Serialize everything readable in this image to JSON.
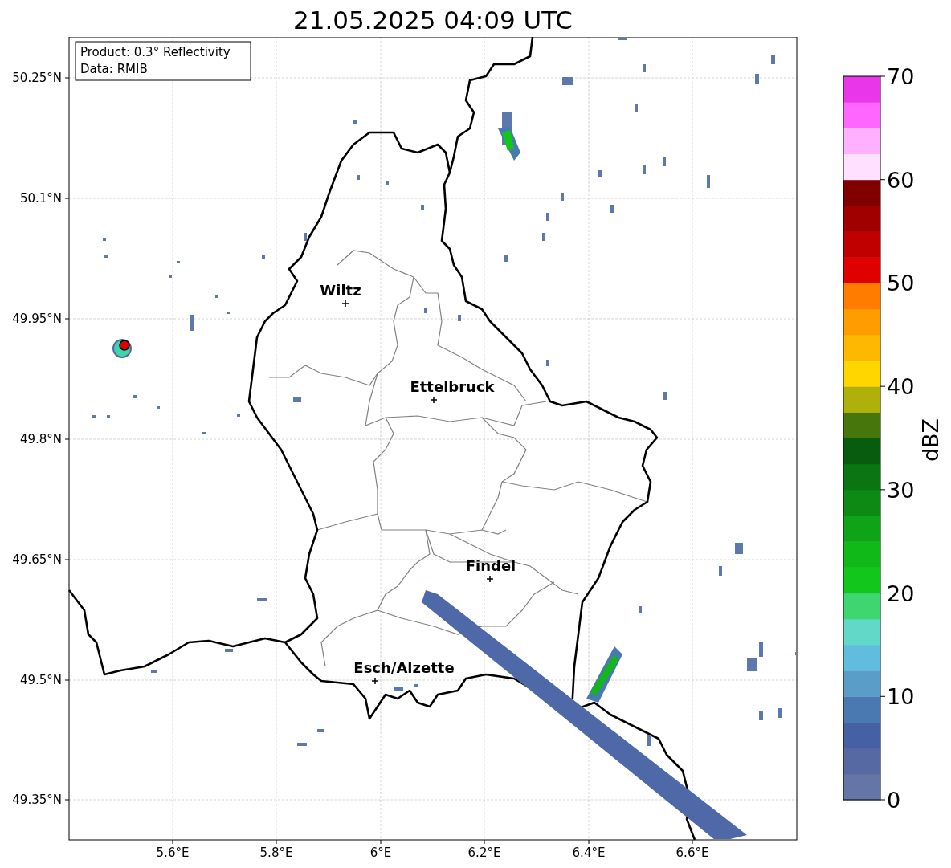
{
  "title": "21.05.2025 04:09 UTC",
  "info_box": {
    "lines": [
      "Product: 0.3° Reflectivity",
      "Data: RMIB"
    ]
  },
  "map": {
    "x_ticks": [
      "5.6°E",
      "5.8°E",
      "6°E",
      "6.2°E",
      "6.4°E",
      "6.6°E"
    ],
    "y_ticks": [
      "50.25°N",
      "50.1°N",
      "49.95°N",
      "49.8°N",
      "49.65°N",
      "49.5°N",
      "49.35°N"
    ],
    "cities": [
      {
        "name": "Wiltz"
      },
      {
        "name": "Ettelbruck"
      },
      {
        "name": "Findel"
      },
      {
        "name": "Esch/Alzette"
      }
    ]
  },
  "colorbar": {
    "label": "dBZ",
    "ticks": [
      "70",
      "60",
      "50",
      "40",
      "30",
      "20",
      "10",
      "0"
    ],
    "bins": [
      {
        "color": "#6675a8"
      },
      {
        "color": "#5669a2"
      },
      {
        "color": "#4560a3"
      },
      {
        "color": "#4a78b0"
      },
      {
        "color": "#5a9dc8"
      },
      {
        "color": "#62bce0"
      },
      {
        "color": "#62d8c8"
      },
      {
        "color": "#3dd671"
      },
      {
        "color": "#13c61c"
      },
      {
        "color": "#10b818"
      },
      {
        "color": "#0fa418"
      },
      {
        "color": "#0d8a13"
      },
      {
        "color": "#0a7512"
      },
      {
        "color": "#085c0e"
      },
      {
        "color": "#47760d"
      },
      {
        "color": "#b0b00a"
      },
      {
        "color": "#ffd600"
      },
      {
        "color": "#ffb800"
      },
      {
        "color": "#ff9c00"
      },
      {
        "color": "#ff7c00"
      },
      {
        "color": "#e00000"
      },
      {
        "color": "#c00000"
      },
      {
        "color": "#a00000"
      },
      {
        "color": "#800000"
      },
      {
        "color": "#ffe0ff"
      },
      {
        "color": "#ffb0ff"
      },
      {
        "color": "#ff66ff"
      },
      {
        "color": "#e836e8"
      }
    ]
  }
}
